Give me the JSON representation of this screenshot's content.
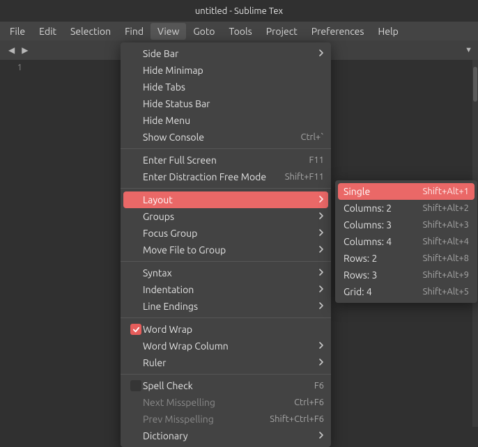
{
  "window": {
    "title": "untitled - Sublime Tex"
  },
  "menubar": {
    "items": [
      "File",
      "Edit",
      "Selection",
      "Find",
      "View",
      "Goto",
      "Tools",
      "Project",
      "Preferences",
      "Help"
    ],
    "active_index": 4
  },
  "gutter": {
    "line1": "1"
  },
  "view_menu": {
    "groups": [
      [
        {
          "label": "Side Bar",
          "submenu": true
        },
        {
          "label": "Hide Minimap"
        },
        {
          "label": "Hide Tabs"
        },
        {
          "label": "Hide Status Bar"
        },
        {
          "label": "Hide Menu"
        },
        {
          "label": "Show Console",
          "accel": "Ctrl+`"
        }
      ],
      [
        {
          "label": "Enter Full Screen",
          "accel": "F11"
        },
        {
          "label": "Enter Distraction Free Mode",
          "accel": "Shift+F11"
        }
      ],
      [
        {
          "label": "Layout",
          "submenu": true,
          "highlighted": true
        },
        {
          "label": "Groups",
          "submenu": true
        },
        {
          "label": "Focus Group",
          "submenu": true
        },
        {
          "label": "Move File to Group",
          "submenu": true
        }
      ],
      [
        {
          "label": "Syntax",
          "submenu": true
        },
        {
          "label": "Indentation",
          "submenu": true
        },
        {
          "label": "Line Endings",
          "submenu": true
        }
      ],
      [
        {
          "label": "Word Wrap",
          "checked": true
        },
        {
          "label": "Word Wrap Column",
          "submenu": true
        },
        {
          "label": "Ruler",
          "submenu": true
        }
      ],
      [
        {
          "label": "Spell Check",
          "accel": "F6",
          "checkbox": true
        },
        {
          "label": "Next Misspelling",
          "accel": "Ctrl+F6",
          "disabled": true
        },
        {
          "label": "Prev Misspelling",
          "accel": "Shift+Ctrl+F6",
          "disabled": true
        },
        {
          "label": "Dictionary",
          "submenu": true
        }
      ]
    ]
  },
  "layout_menu": {
    "items": [
      {
        "label": "Single",
        "accel": "Shift+Alt+1",
        "highlighted": true
      },
      {
        "label": "Columns: 2",
        "accel": "Shift+Alt+2"
      },
      {
        "label": "Columns: 3",
        "accel": "Shift+Alt+3"
      },
      {
        "label": "Columns: 4",
        "accel": "Shift+Alt+4"
      },
      {
        "label": "Rows: 2",
        "accel": "Shift+Alt+8"
      },
      {
        "label": "Rows: 3",
        "accel": "Shift+Alt+9"
      },
      {
        "label": "Grid: 4",
        "accel": "Shift+Alt+5"
      }
    ]
  }
}
